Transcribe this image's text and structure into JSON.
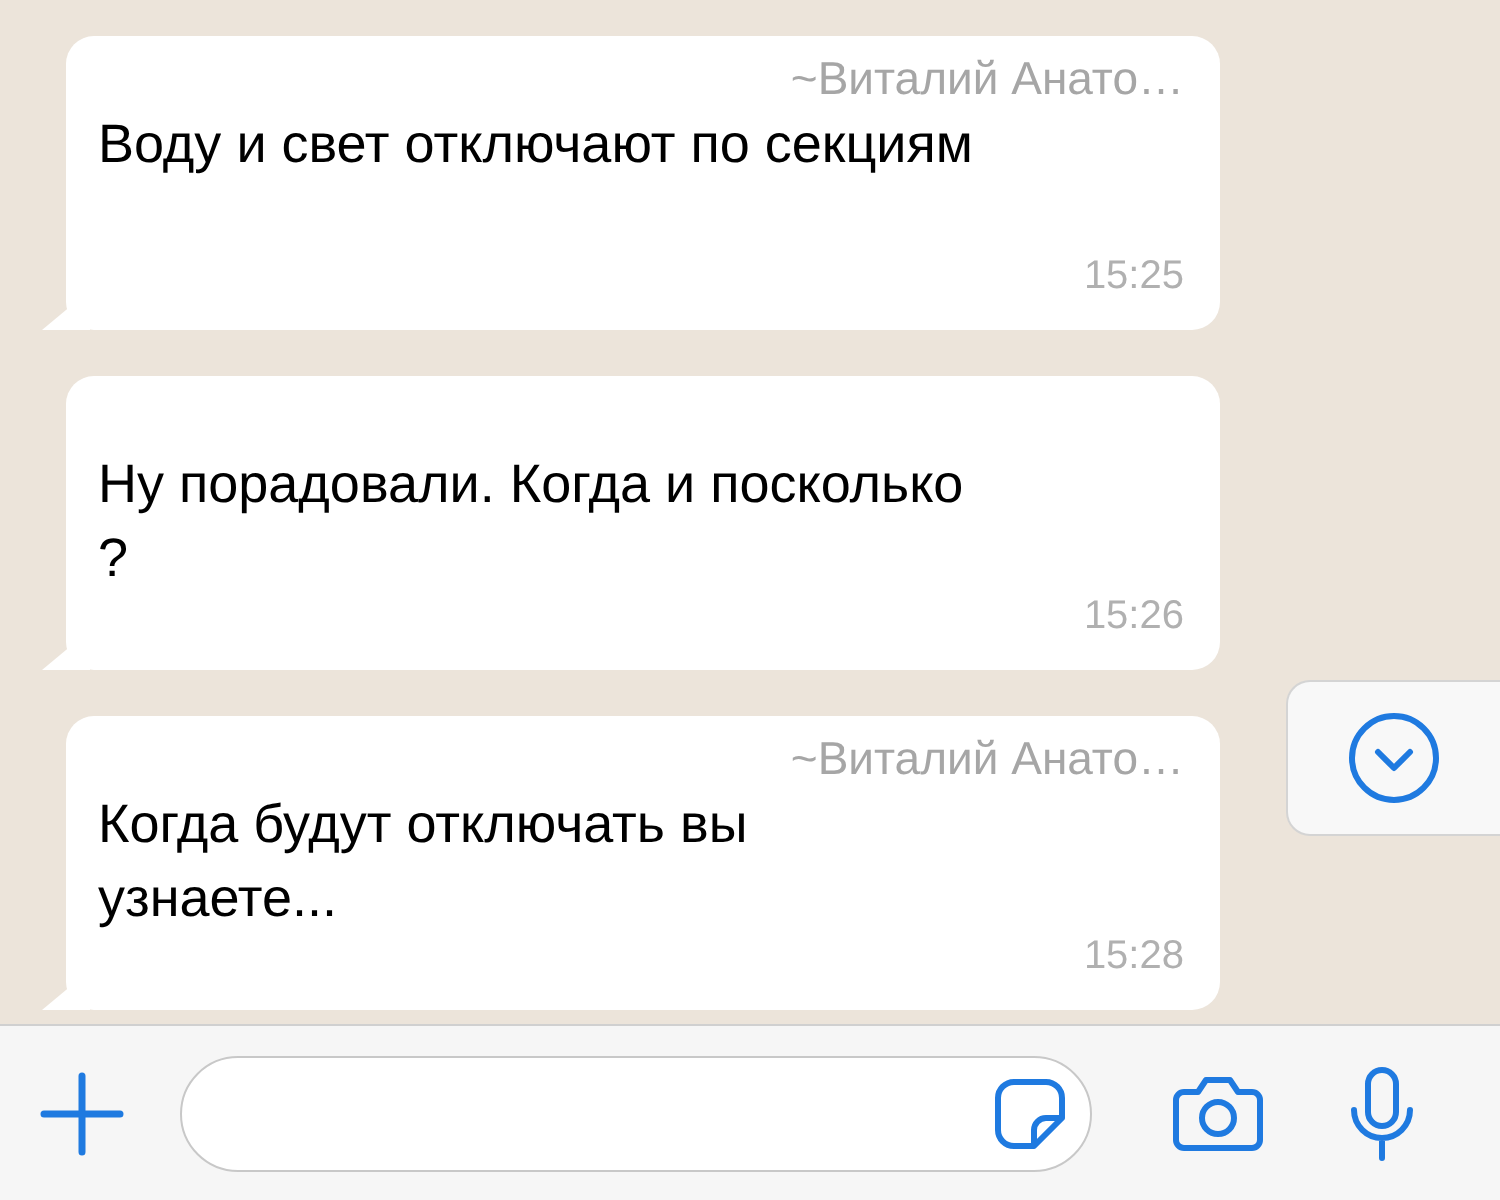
{
  "messages": [
    {
      "sender": "~Виталий Анато…",
      "text": "Воду и свет отключают по секциям",
      "time": "15:25"
    },
    {
      "text": "Ну порадовали. Когда и посколько ?",
      "time": "15:26"
    },
    {
      "sender": "~Виталий Анато…",
      "text": "Когда будут отключать вы узнаете...",
      "time": "15:28"
    }
  ]
}
